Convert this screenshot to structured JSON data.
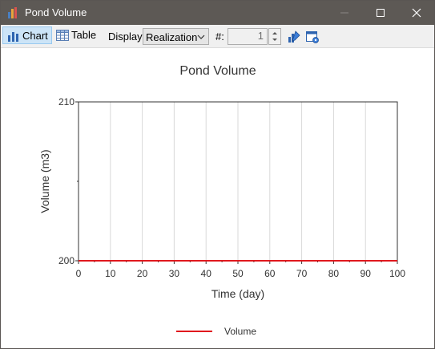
{
  "window": {
    "title": "Pond Volume"
  },
  "toolbar": {
    "chart_label": "Chart",
    "table_label": "Table",
    "display_label": "Display:",
    "display_value": "Realization",
    "hash_label": "#:",
    "realization_number": "1"
  },
  "colors": {
    "series": "#e0191e",
    "titlebar": "#5d5955",
    "selected_tab": "#cce4f7"
  },
  "chart_data": {
    "type": "line",
    "title": "Pond Volume",
    "xlabel": "Time (day)",
    "ylabel": "Volume (m3)",
    "xlim": [
      0,
      100
    ],
    "ylim": [
      200,
      210
    ],
    "x_ticks": [
      0,
      10,
      20,
      30,
      40,
      50,
      60,
      70,
      80,
      90,
      100
    ],
    "y_ticks": [
      200,
      210
    ],
    "grid": true,
    "legend": "bottom",
    "series": [
      {
        "name": "Volume",
        "x": [
          0,
          100
        ],
        "y": [
          200,
          200
        ]
      }
    ]
  }
}
